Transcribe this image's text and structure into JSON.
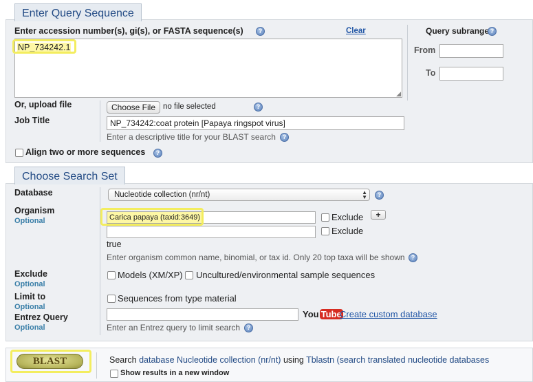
{
  "query_section": {
    "legend": "Enter Query Sequence",
    "input_label": "Enter accession number(s), gi(s), or FASTA sequence(s)",
    "clear_label": "Clear",
    "query_value": "NP_734242.1",
    "subrange_label": "Query subrange",
    "from_label": "From",
    "to_label": "To",
    "from_value": "",
    "to_value": "",
    "upload_label": "Or, upload file",
    "choose_file_label": "Choose File",
    "no_file_text": "no file selected",
    "job_title_label": "Job Title",
    "job_title_value": "NP_734242:coat protein [Papaya ringspot virus]",
    "job_title_hint": "Enter a descriptive title for your BLAST search",
    "align_label": "Align two or more sequences"
  },
  "search_set": {
    "legend": "Choose Search Set",
    "database_label": "Database",
    "database_value": "Nucleotide collection (nr/nt)",
    "organism_label": "Organism",
    "optional_label": "Optional",
    "organism_value": "Carica papaya (taxid:3649)",
    "organism_value_2": "",
    "exclude_label": "Exclude",
    "plus_label": "+",
    "true_text": "true",
    "organism_hint": "Enter organism common name, binomial, or tax id. Only 20 top taxa will be shown",
    "exclude_section_label": "Exclude",
    "models_label": "Models (XM/XP)",
    "uncultured_label": "Uncultured/environmental sample sequences",
    "limit_label": "Limit to",
    "type_material_label": "Sequences from type material",
    "entrez_label": "Entrez Query",
    "entrez_value": "",
    "youtube_you": "You",
    "youtube_tube": "Tube",
    "custom_db_link": "Create custom database",
    "entrez_hint": "Enter an Entrez query to limit search"
  },
  "blast_bar": {
    "button_label": "BLAST",
    "search_prefix": "Search ",
    "search_db": "database Nucleotide collection (nr/nt)",
    "search_using": " using ",
    "search_program": "Tblastn (search translated nucleotide databases",
    "new_window_label": "Show results in a new window"
  },
  "colors": {
    "accent": "#234b85",
    "link": "#2055a5",
    "highlight": "#fdf7a5",
    "panel": "#eef0f3"
  }
}
